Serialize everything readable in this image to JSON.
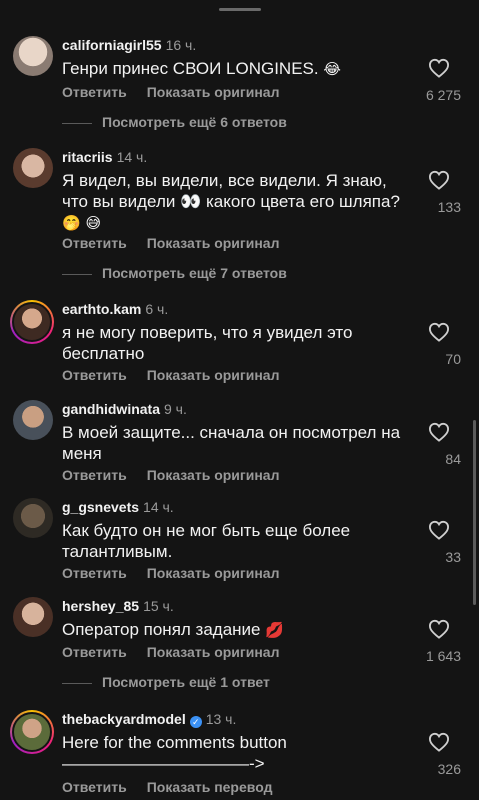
{
  "comments": [
    {
      "username": "californiagirl55",
      "time": "16 ч.",
      "text": "Генри принес СВОИ LONGINES.",
      "emoji": "😂",
      "reply": "Ответить",
      "secondary": "Показать оригинал",
      "likes": "6 275",
      "more_replies": "Посмотреть ещё 6 ответов"
    },
    {
      "username": "ritacriis",
      "time": "14 ч.",
      "text": "Я видел, вы видели, все видели. Я знаю, что вы видели 👀 какого цвета его шляпа?",
      "emoji": "🤭 😅",
      "reply": "Ответить",
      "secondary": "Показать оригинал",
      "likes": "133",
      "more_replies": "Посмотреть ещё 7 ответов"
    },
    {
      "username": "earthto.kam",
      "time": "6 ч.",
      "text": "я не могу поверить, что я увидел это бесплатно",
      "reply": "Ответить",
      "secondary": "Показать оригинал",
      "likes": "70"
    },
    {
      "username": "gandhidwinata",
      "time": "9 ч.",
      "text": "В моей защите... сначала он посмотрел на меня",
      "reply": "Ответить",
      "secondary": "Показать оригинал",
      "likes": "84"
    },
    {
      "username": "g_gsnevets",
      "time": "14 ч.",
      "text": "Как будто он не мог быть еще более талантливым.",
      "reply": "Ответить",
      "secondary": "Показать оригинал",
      "likes": "33"
    },
    {
      "username": "hershey_85",
      "time": "15 ч.",
      "text": "Оператор понял задание",
      "emoji": "💋",
      "reply": "Ответить",
      "secondary": "Показать оригинал",
      "likes": "1 643",
      "more_replies": "Посмотреть ещё 1 ответ"
    },
    {
      "username": "thebackyardmodel",
      "time": "13 ч.",
      "verified_mark": "✓",
      "text": "Here for the comments button",
      "text_line2": "———————————->",
      "reply": "Ответить",
      "secondary": "Показать перевод",
      "likes": "326"
    }
  ],
  "colors": {
    "background": "#141414",
    "text": "#f2f2f2",
    "muted": "#9a9a9a",
    "verified": "#3b91f5"
  },
  "icons": {
    "like": "heart-outline-icon",
    "verified": "verified-badge-icon"
  }
}
